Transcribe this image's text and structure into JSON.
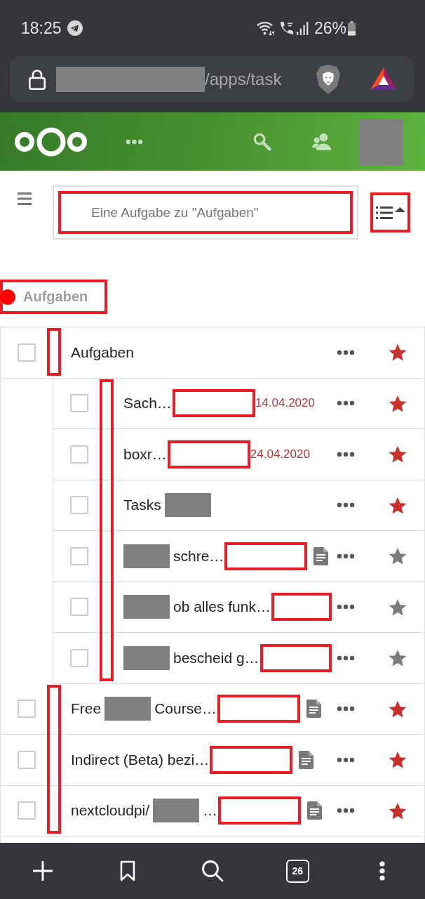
{
  "status_bar": {
    "time": "18:25",
    "battery": "26%"
  },
  "address_bar": {
    "url": [
      {
        "kind": "redacted"
      },
      {
        "kind": "text",
        "text": "/apps/task"
      }
    ]
  },
  "app_header": {
    "avatar": {
      "kind": "redacted"
    }
  },
  "search": {
    "placeholder": "Eine Aufgabe zu \"Aufgaben\"",
    "highlighted": true
  },
  "sort_button": {
    "highlighted": true
  },
  "list": {
    "name": "Aufgaben",
    "color": "#ff0000",
    "highlighted": true
  },
  "tasks": [
    {
      "title": [
        {
          "kind": "text",
          "text": "Aufgaben"
        }
      ],
      "checked": false,
      "starred": true,
      "has_note": false,
      "ellipsis_highlighted": false,
      "guide_highlighted": true,
      "children": [
        {
          "title": [
            {
              "kind": "text",
              "text": "Sach…"
            }
          ],
          "due": "14.04.2020",
          "checked": false,
          "starred": true,
          "has_note": false,
          "ellipsis_highlighted": true,
          "guide_highlighted": true
        },
        {
          "title": [
            {
              "kind": "text",
              "text": "boxr…"
            }
          ],
          "due": "24.04.2020",
          "checked": false,
          "starred": true,
          "has_note": false,
          "ellipsis_highlighted": true,
          "guide_highlighted": true
        },
        {
          "title": [
            {
              "kind": "text",
              "text": "Tasks"
            },
            {
              "kind": "redacted"
            }
          ],
          "checked": false,
          "starred": true,
          "has_note": false,
          "ellipsis_highlighted": false,
          "guide_highlighted": true
        },
        {
          "title": [
            {
              "kind": "redacted"
            },
            {
              "kind": "text",
              "text": "schre…"
            }
          ],
          "checked": false,
          "starred": false,
          "has_note": true,
          "ellipsis_highlighted": true,
          "guide_highlighted": true
        },
        {
          "title": [
            {
              "kind": "redacted"
            },
            {
              "kind": "text",
              "text": "ob alles funk…"
            }
          ],
          "checked": false,
          "starred": false,
          "has_note": false,
          "ellipsis_highlighted": true,
          "guide_highlighted": true
        },
        {
          "title": [
            {
              "kind": "redacted"
            },
            {
              "kind": "text",
              "text": "bescheid g…"
            }
          ],
          "checked": false,
          "starred": false,
          "has_note": false,
          "ellipsis_highlighted": true,
          "guide_highlighted": true
        }
      ]
    },
    {
      "title": [
        {
          "kind": "text",
          "text": "Free"
        },
        {
          "kind": "redacted"
        },
        {
          "kind": "text",
          "text": "Course…"
        }
      ],
      "checked": false,
      "starred": true,
      "has_note": true,
      "ellipsis_highlighted": true,
      "guide_highlighted": true
    },
    {
      "title": [
        {
          "kind": "text",
          "text": "Indirect (Beta) bezi…"
        }
      ],
      "checked": false,
      "starred": true,
      "has_note": true,
      "ellipsis_highlighted": true,
      "guide_highlighted": true
    },
    {
      "title": [
        {
          "kind": "text",
          "text": "nextcloudpi/"
        },
        {
          "kind": "redacted"
        },
        {
          "kind": "text",
          "text": "…"
        }
      ],
      "checked": false,
      "starred": true,
      "has_note": true,
      "ellipsis_highlighted": true,
      "guide_highlighted": true
    }
  ],
  "bottom_bar": {
    "tab_count": "26"
  }
}
